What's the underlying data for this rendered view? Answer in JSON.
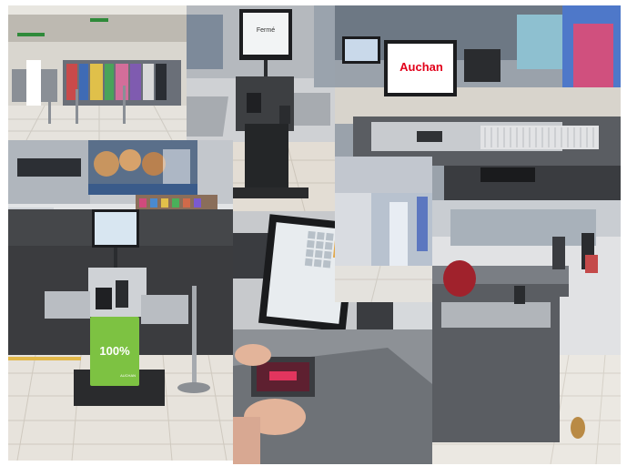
{
  "collage": {
    "photos": [
      {
        "id": "store-aisle"
      },
      {
        "id": "kiosk-idle"
      },
      {
        "id": "auchan-register"
      },
      {
        "id": "poster-shelves"
      },
      {
        "id": "kiosk-green-bag"
      },
      {
        "id": "scanner-closeup"
      },
      {
        "id": "store-entrance"
      },
      {
        "id": "checkout-lanes"
      }
    ]
  },
  "texts": {
    "kiosk_screen": "Fermé",
    "brand_logo": "Auchan",
    "bag_label": "100%",
    "bag_small": "AUCHAN"
  },
  "colors": {
    "auchan_red": "#e2001a",
    "bag_green": "#7dc242",
    "floor_tile": "#e9e6e0",
    "counter_gray": "#5a5d62"
  }
}
